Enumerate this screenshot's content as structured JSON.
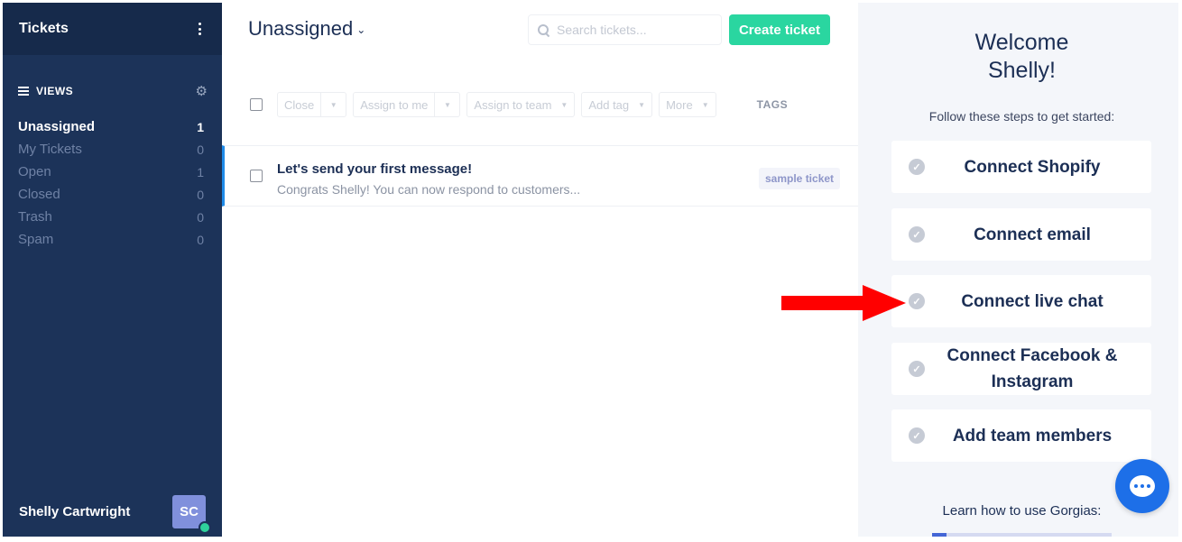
{
  "sidebar": {
    "title": "Tickets",
    "views_label": "VIEWS",
    "views": [
      {
        "label": "Unassigned",
        "count": "1"
      },
      {
        "label": "My Tickets",
        "count": "0"
      },
      {
        "label": "Open",
        "count": "1"
      },
      {
        "label": "Closed",
        "count": "0"
      },
      {
        "label": "Trash",
        "count": "0"
      },
      {
        "label": "Spam",
        "count": "0"
      }
    ],
    "user_name": "Shelly Cartwright",
    "user_initials": "SC",
    "online_color": "#2fd29c"
  },
  "main": {
    "view_title": "Unassigned",
    "search_placeholder": "Search tickets...",
    "create_button": "Create ticket",
    "toolbar": {
      "close": "Close",
      "assign_me": "Assign to me",
      "assign_team": "Assign to team",
      "add_tag": "Add tag",
      "more": "More",
      "tags_header": "TAGS"
    },
    "tickets": [
      {
        "subject": "Let's send your first message!",
        "preview": "Congrats Shelly! You can now respond to customers...",
        "tag": "sample ticket"
      }
    ]
  },
  "onboarding": {
    "welcome_line1": "Welcome",
    "welcome_line2": "Shelly!",
    "subtitle": "Follow these steps to get started:",
    "steps": [
      {
        "label": "Connect Shopify"
      },
      {
        "label": "Connect email"
      },
      {
        "label": "Connect live chat"
      },
      {
        "label": "Connect Facebook & Instagram"
      },
      {
        "label": "Add team members"
      }
    ],
    "learn_text": "Learn how to use Gorgias:",
    "learn_progress": 0.08
  },
  "colors": {
    "sidebar_bg": "#1c3359",
    "accent_green": "#2ad6a0",
    "chat_blue": "#1d6fe8",
    "arrow_red": "#ff0000"
  }
}
